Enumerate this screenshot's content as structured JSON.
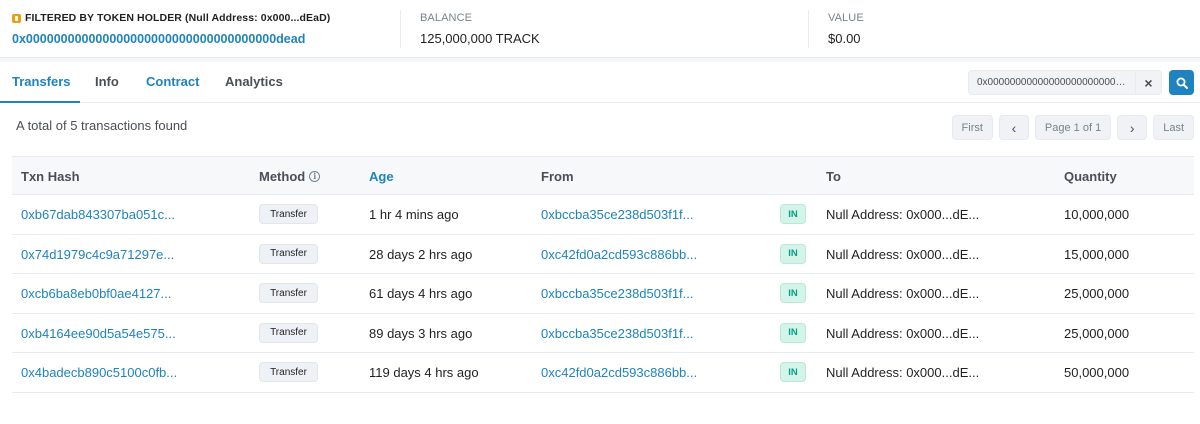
{
  "header": {
    "filter_label": "FILTERED BY TOKEN HOLDER (Null Address: 0x000...dEaD)",
    "address": "0x000000000000000000000000000000000000dead",
    "balance_label": "BALANCE",
    "balance_value": "125,000,000 TRACK",
    "value_label": "VALUE",
    "value_amount": "$0.00",
    "filter_icon_color": "#e9a20d"
  },
  "tabs": [
    {
      "label": "Transfers",
      "active": true
    },
    {
      "label": "Info",
      "active": false
    },
    {
      "label": "Contract",
      "active": false
    },
    {
      "label": "Analytics",
      "active": false
    }
  ],
  "search": {
    "value": "0x000000000000000000000000000000000000dead",
    "clear_icon": "close-icon",
    "search_icon": "search-icon"
  },
  "summary": "A total of 5 transactions found",
  "pagination": {
    "first": "First",
    "prev": "‹",
    "page": "Page 1 of 1",
    "next": "›",
    "last": "Last"
  },
  "table": {
    "headers": {
      "txn_hash": "Txn Hash",
      "method": "Method",
      "age": "Age",
      "from": "From",
      "to": "To",
      "quantity": "Quantity"
    },
    "rows": [
      {
        "hash": "0xb67dab843307ba051c...",
        "method": "Transfer",
        "age": "1 hr 4 mins ago",
        "from": "0xbccba35ce238d503f1f...",
        "direction": "IN",
        "to": "Null Address: 0x000...dE...",
        "quantity": "10,000,000"
      },
      {
        "hash": "0x74d1979c4c9a71297e...",
        "method": "Transfer",
        "age": "28 days 2 hrs ago",
        "from": "0xc42fd0a2cd593c886bb...",
        "direction": "IN",
        "to": "Null Address: 0x000...dE...",
        "quantity": "15,000,000"
      },
      {
        "hash": "0xcb6ba8eb0bf0ae4127...",
        "method": "Transfer",
        "age": "61 days 4 hrs ago",
        "from": "0xbccba35ce238d503f1f...",
        "direction": "IN",
        "to": "Null Address: 0x000...dE...",
        "quantity": "25,000,000"
      },
      {
        "hash": "0xb4164ee90d5a54e575...",
        "method": "Transfer",
        "age": "89 days 3 hrs ago",
        "from": "0xbccba35ce238d503f1f...",
        "direction": "IN",
        "to": "Null Address: 0x000...dE...",
        "quantity": "25,000,000"
      },
      {
        "hash": "0x4badecb890c5100c0fb...",
        "method": "Transfer",
        "age": "119 days 4 hrs ago",
        "from": "0xc42fd0a2cd593c886bb...",
        "direction": "IN",
        "to": "Null Address: 0x000...dE...",
        "quantity": "50,000,000"
      }
    ]
  },
  "colors": {
    "link": "#1e83be",
    "in_badge_bg": "#d4f4e9",
    "in_badge_text": "#00a186"
  }
}
